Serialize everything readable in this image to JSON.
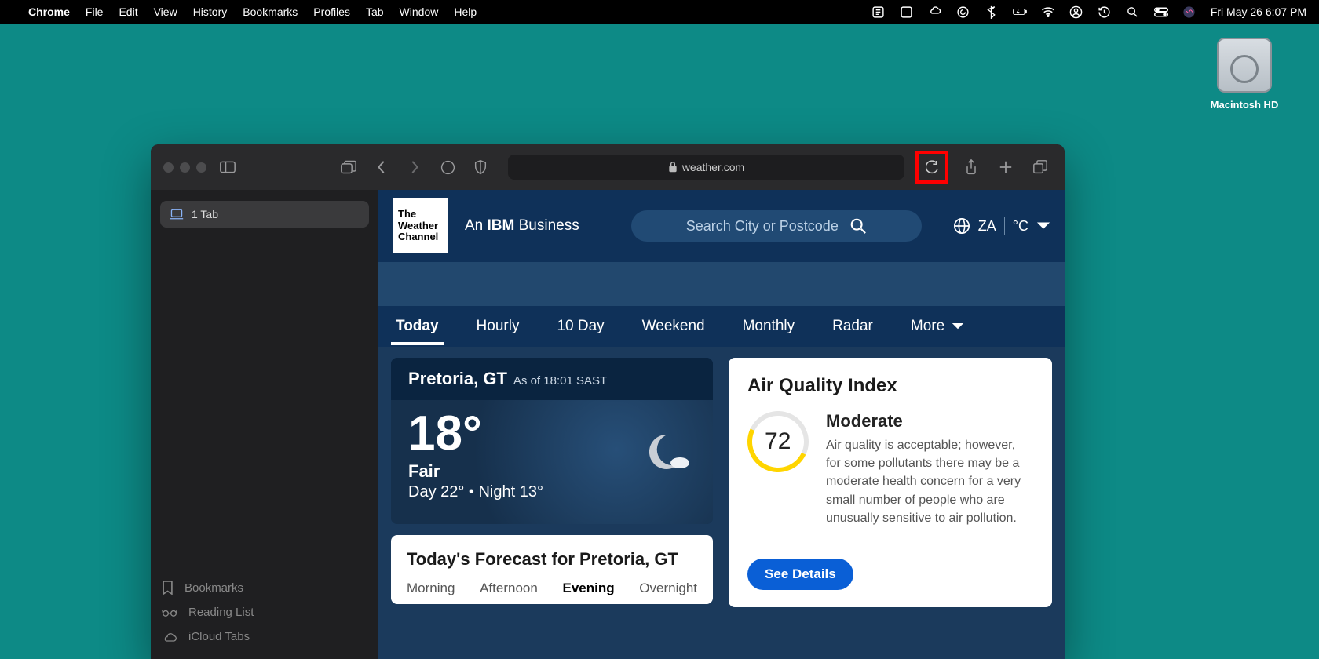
{
  "menubar": {
    "app": "Chrome",
    "items": [
      "File",
      "Edit",
      "View",
      "History",
      "Bookmarks",
      "Profiles",
      "Tab",
      "Window",
      "Help"
    ],
    "clock": "Fri May 26  6:07 PM"
  },
  "desktop": {
    "drive_label": "Macintosh HD"
  },
  "browser": {
    "url": "weather.com",
    "tab_count_label": "1 Tab",
    "sidebar": {
      "bookmarks": "Bookmarks",
      "reading_list": "Reading List",
      "icloud_tabs": "iCloud Tabs"
    }
  },
  "weather": {
    "logo_lines": "The\nWeather\nChannel",
    "tagline_prefix": "An ",
    "tagline_brand": "IBM",
    "tagline_suffix": " Business",
    "search_placeholder": "Search City or Postcode",
    "locale_region": "ZA",
    "locale_unit": "°C",
    "tabs": [
      "Today",
      "Hourly",
      "10 Day",
      "Weekend",
      "Monthly",
      "Radar",
      "More"
    ],
    "active_tab": "Today",
    "now": {
      "location": "Pretoria, GT",
      "timestamp": "As of 18:01 SAST",
      "temp": "18°",
      "condition": "Fair",
      "day_night": "Day 22° • Night 13°"
    },
    "forecast": {
      "title": "Today's Forecast for Pretoria, GT",
      "segments": [
        "Morning",
        "Afternoon",
        "Evening",
        "Overnight"
      ],
      "active_segment": "Evening"
    },
    "aqi": {
      "title": "Air Quality Index",
      "value": "72",
      "level": "Moderate",
      "description": "Air quality is acceptable; however, for some pollutants there may be a moderate health concern for a very small number of people who are unusually sensitive to air pollution.",
      "cta": "See Details"
    }
  }
}
